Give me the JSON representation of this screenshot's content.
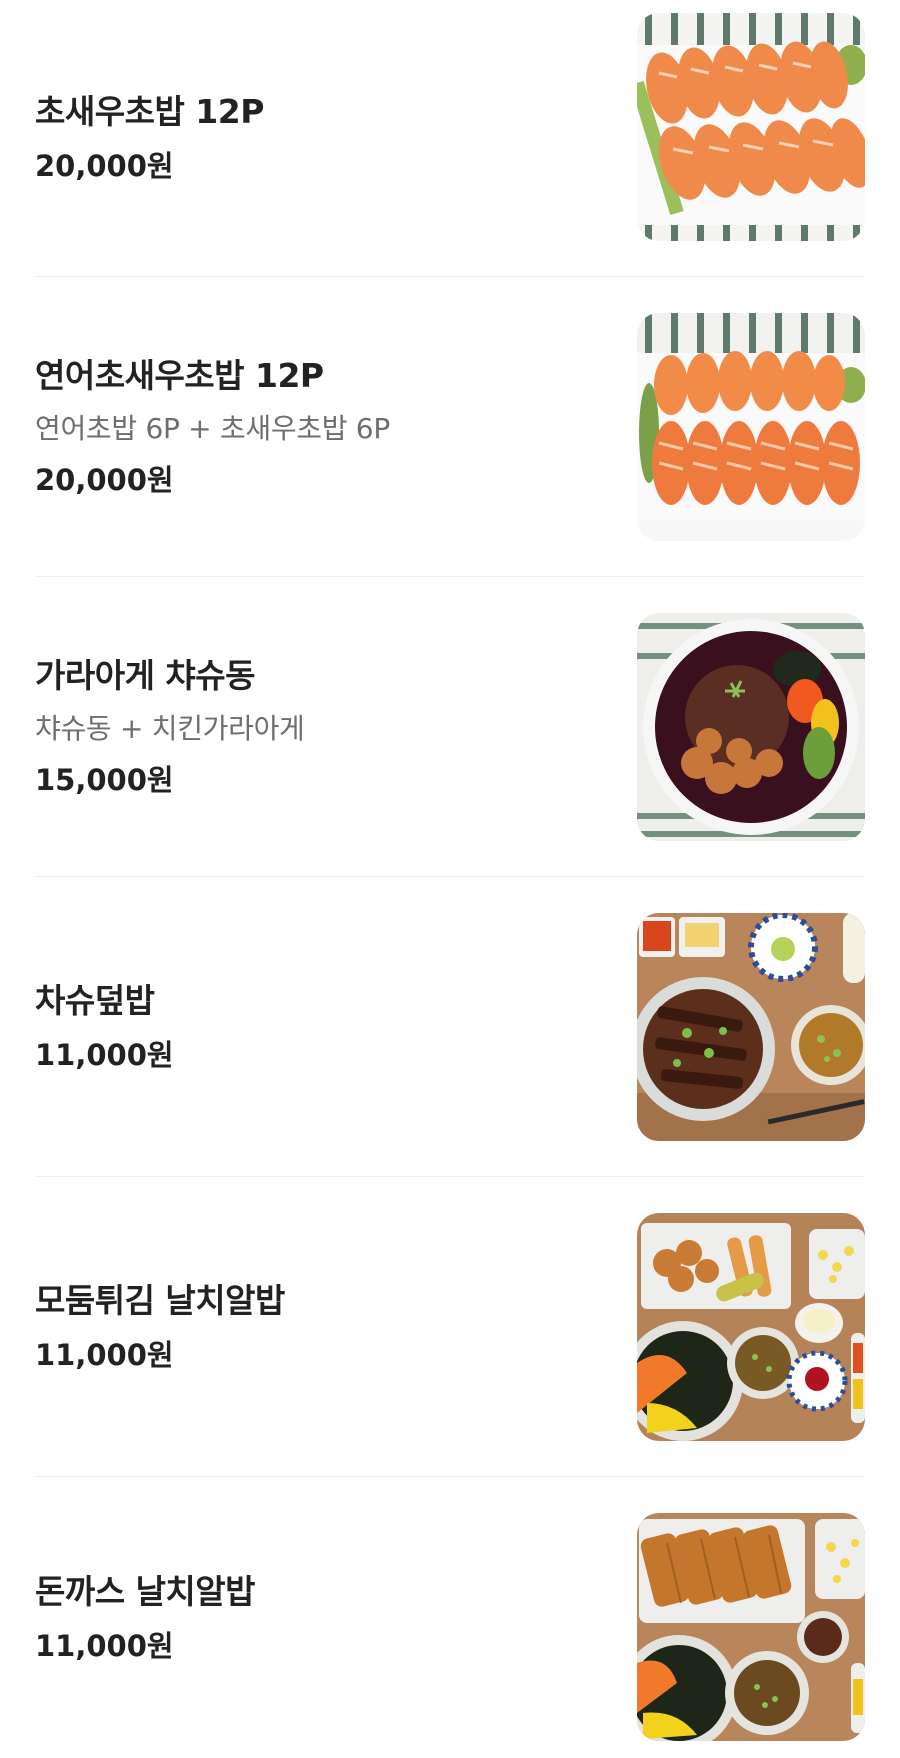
{
  "menu": {
    "items": [
      {
        "name": "초새우초밥 12P",
        "description": "",
        "price": "20,000원",
        "photo": "shrimp-sushi-photo"
      },
      {
        "name": "연어초새우초밥 12P",
        "description": "연어초밥 6P + 초새우초밥 6P",
        "price": "20,000원",
        "photo": "salmon-shrimp-sushi-photo"
      },
      {
        "name": "가라아게 챠슈동",
        "description": "챠슈동 + 치킨가라아게",
        "price": "15,000원",
        "photo": "karaage-chashudon-photo"
      },
      {
        "name": "차슈덮밥",
        "description": "",
        "price": "11,000원",
        "photo": "chashu-rice-bowl-photo"
      },
      {
        "name": "모둠튀김 날치알밥",
        "description": "",
        "price": "11,000원",
        "photo": "tempura-roe-rice-photo"
      },
      {
        "name": "돈까스 날치알밥",
        "description": "",
        "price": "11,000원",
        "photo": "pork-cutlet-roe-rice-photo"
      }
    ]
  },
  "colors": {
    "text_primary": "#222222",
    "text_secondary": "#6e6e6e",
    "divider": "#f0f0f0",
    "background": "#ffffff"
  }
}
